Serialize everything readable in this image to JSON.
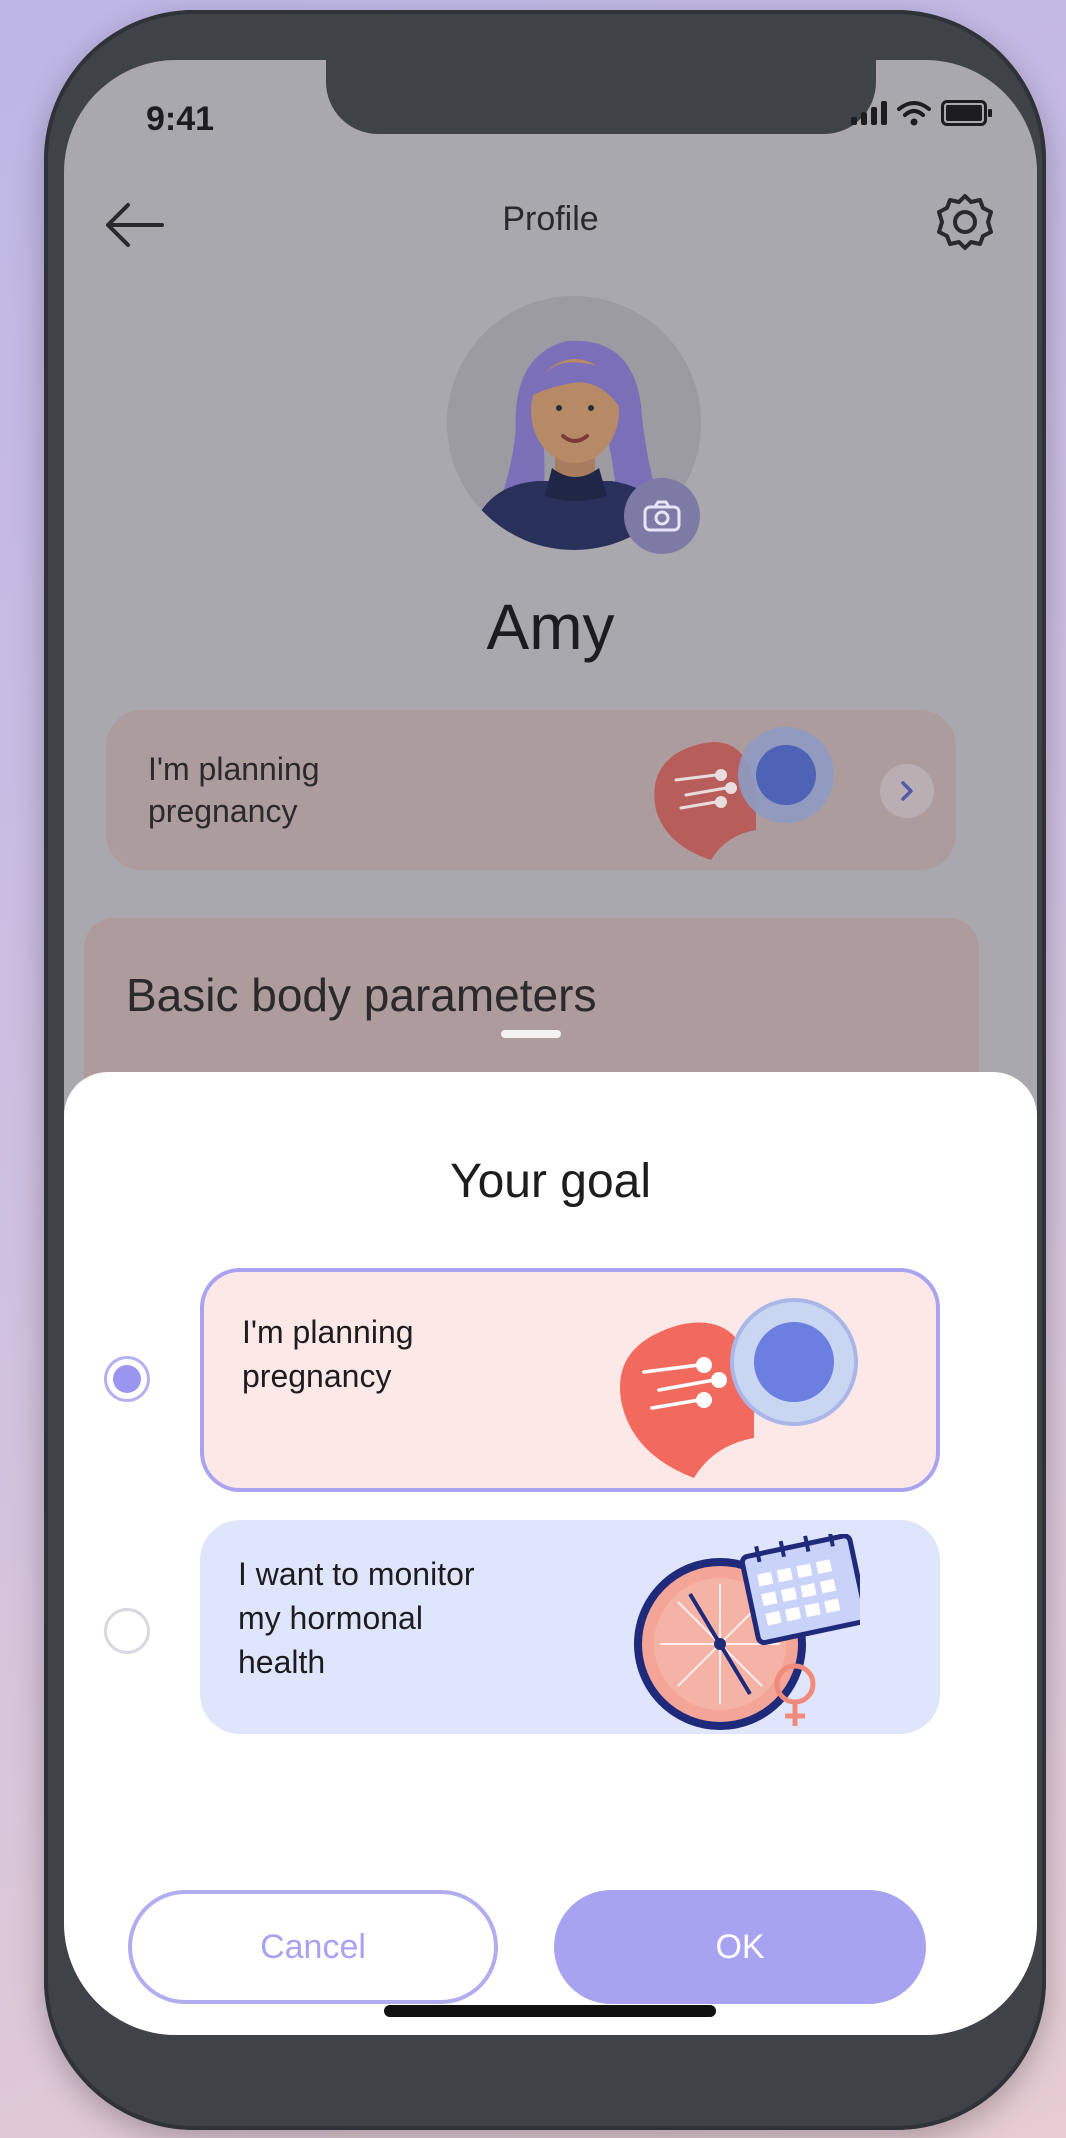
{
  "status_bar": {
    "time": "9:41"
  },
  "header": {
    "title": "Profile"
  },
  "profile": {
    "name": "Amy"
  },
  "goal_card": {
    "line1": "I'm planning",
    "line2": "pregnancy"
  },
  "body_parameters": {
    "title": "Basic body parameters"
  },
  "sheet": {
    "title": "Your goal",
    "options": [
      {
        "line1": "I'm planning",
        "line2": "pregnancy",
        "selected": true
      },
      {
        "line1": "I want to monitor",
        "line2": "my hormonal",
        "line3": "health",
        "selected": false
      }
    ],
    "cancel_label": "Cancel",
    "ok_label": "OK"
  },
  "colors": {
    "accent": "#a8a3f0",
    "pregnancy_card": "#fde8e8",
    "hormonal_card": "#dfe5fb",
    "heart": "#f26a5e"
  },
  "icons": [
    "back-arrow-icon",
    "gear-icon",
    "camera-icon",
    "chevron-right-icon",
    "signal-icon",
    "wifi-icon",
    "battery-icon"
  ]
}
